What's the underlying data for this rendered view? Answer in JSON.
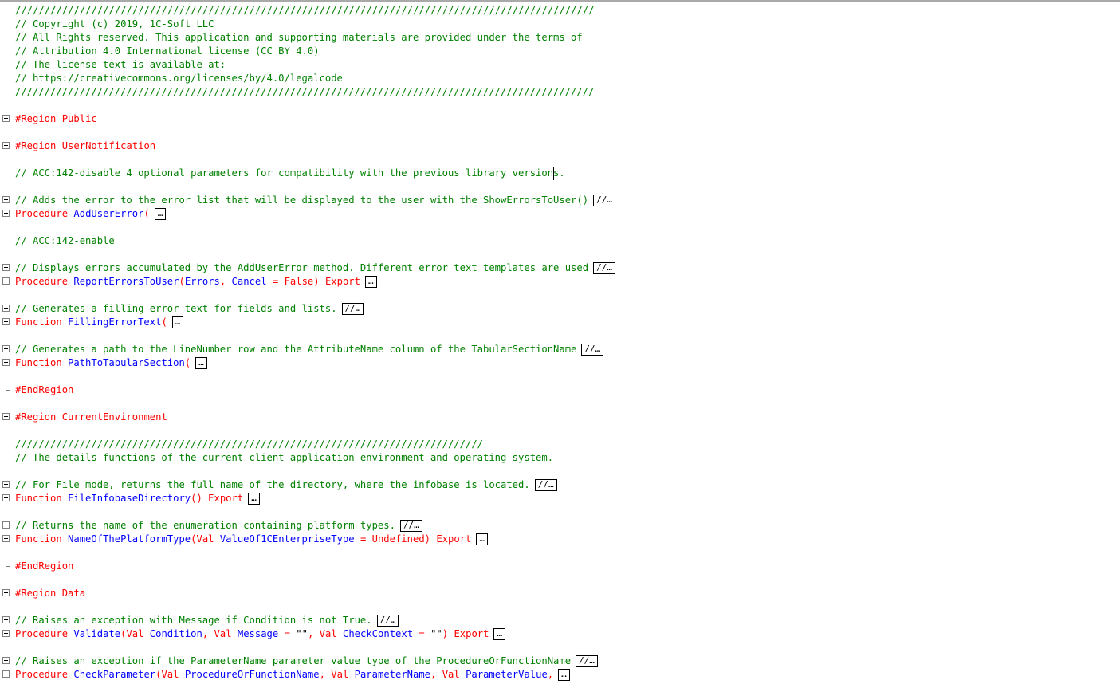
{
  "lines": [
    {
      "type": "comment",
      "text": "///////////////////////////////////////////////////////////////////////////////////////////////////"
    },
    {
      "type": "comment",
      "text": "// Copyright (c) 2019, 1C-Soft LLC"
    },
    {
      "type": "comment",
      "text": "// All Rights reserved. This application and supporting materials are provided under the terms of"
    },
    {
      "type": "comment",
      "text": "// Attribution 4.0 International license (CC BY 4.0)"
    },
    {
      "type": "comment",
      "text": "// The license text is available at:"
    },
    {
      "type": "comment",
      "text": "// https://creativecommons.org/licenses/by/4.0/legalcode"
    },
    {
      "type": "comment",
      "text": "///////////////////////////////////////////////////////////////////////////////////////////////////"
    },
    {
      "type": "blank"
    },
    {
      "type": "region",
      "fold": "minus",
      "keyword": "#Region",
      "name": "Public"
    },
    {
      "type": "blank"
    },
    {
      "type": "region",
      "fold": "minus",
      "keyword": "#Region",
      "name": "UserNotification"
    },
    {
      "type": "blank"
    },
    {
      "type": "comment",
      "text": "// ACC:142-disable 4 optional parameters for compatibility with the previous library versions."
    },
    {
      "type": "blank"
    },
    {
      "type": "comment",
      "fold": "plus",
      "text": "// Adds the error to the error list that will be displayed to the user with the ShowErrorsToUser()",
      "collapsed": "//…"
    },
    {
      "type": "method",
      "fold": "plus",
      "keyword": "Procedure",
      "name": "AddUserError",
      "params": "(",
      "tail": "",
      "collapsed": "…"
    },
    {
      "type": "blank"
    },
    {
      "type": "comment",
      "text": "// ACC:142-enable"
    },
    {
      "type": "blank"
    },
    {
      "type": "comment",
      "fold": "plus",
      "text": "// Displays errors accumulated by the AddUserError method. Different error text templates are used",
      "collapsed": "//…"
    },
    {
      "type": "method",
      "fold": "plus",
      "keyword": "Procedure",
      "name": "ReportErrorsToUser",
      "params": "(Errors, Cancel = False)",
      "tail": "Export",
      "collapsed": "…"
    },
    {
      "type": "blank"
    },
    {
      "type": "comment",
      "fold": "plus",
      "text": "// Generates a filling error text for fields and lists.",
      "collapsed": "//…"
    },
    {
      "type": "method",
      "fold": "plus",
      "keyword": "Function",
      "name": "FillingErrorText",
      "params": "(",
      "tail": "",
      "collapsed": "…"
    },
    {
      "type": "blank"
    },
    {
      "type": "comment",
      "fold": "plus",
      "text": "// Generates a path to the LineNumber row and the AttributeName column of the TabularSectionName",
      "collapsed": "//…"
    },
    {
      "type": "method",
      "fold": "plus",
      "keyword": "Function",
      "name": "PathToTabularSection",
      "params": "(",
      "tail": "",
      "collapsed": "…"
    },
    {
      "type": "blank"
    },
    {
      "type": "endregion",
      "keyword": "#EndRegion"
    },
    {
      "type": "blank"
    },
    {
      "type": "region",
      "fold": "minus",
      "keyword": "#Region",
      "name": "CurrentEnvironment"
    },
    {
      "type": "blank"
    },
    {
      "type": "comment",
      "text": "////////////////////////////////////////////////////////////////////////////////"
    },
    {
      "type": "comment",
      "text": "// The details functions of the current client application environment and operating system."
    },
    {
      "type": "blank"
    },
    {
      "type": "comment",
      "fold": "plus",
      "text": "// For File mode, returns the full name of the directory, where the infobase is located.",
      "collapsed": "//…"
    },
    {
      "type": "method",
      "fold": "plus",
      "keyword": "Function",
      "name": "FileInfobaseDirectory",
      "params": "()",
      "tail": "Export",
      "collapsed": "…"
    },
    {
      "type": "blank"
    },
    {
      "type": "comment",
      "fold": "plus",
      "text": "// Returns the name of the enumeration containing platform types.",
      "collapsed": "//…"
    },
    {
      "type": "method",
      "fold": "plus",
      "keyword": "Function",
      "name": "NameOfThePlatformType",
      "params": "(Val ValueOf1CEnterpriseType = Undefined)",
      "tail": "Export",
      "collapsed": "…"
    },
    {
      "type": "blank"
    },
    {
      "type": "endregion",
      "keyword": "#EndRegion"
    },
    {
      "type": "blank"
    },
    {
      "type": "region",
      "fold": "minus",
      "keyword": "#Region",
      "name": "Data"
    },
    {
      "type": "blank"
    },
    {
      "type": "comment",
      "fold": "plus",
      "text": "// Raises an exception with Message if Condition is not True.",
      "collapsed": "//…"
    },
    {
      "type": "method",
      "fold": "plus",
      "keyword": "Procedure",
      "name": "Validate",
      "params": "(Val Condition, Val Message = \"\", Val CheckContext = \"\")",
      "tail": "Export",
      "collapsed": "…"
    },
    {
      "type": "blank"
    },
    {
      "type": "comment",
      "fold": "plus",
      "text": "// Raises an exception if the ParameterName parameter value type of the ProcedureOrFunctionName",
      "collapsed": "//…"
    },
    {
      "type": "method",
      "fold": "plus",
      "keyword": "Procedure",
      "name": "CheckParameter",
      "params": "(Val ProcedureOrFunctionName, Val ParameterName, Val ParameterValue,",
      "tail": "",
      "collapsed": "…"
    }
  ]
}
